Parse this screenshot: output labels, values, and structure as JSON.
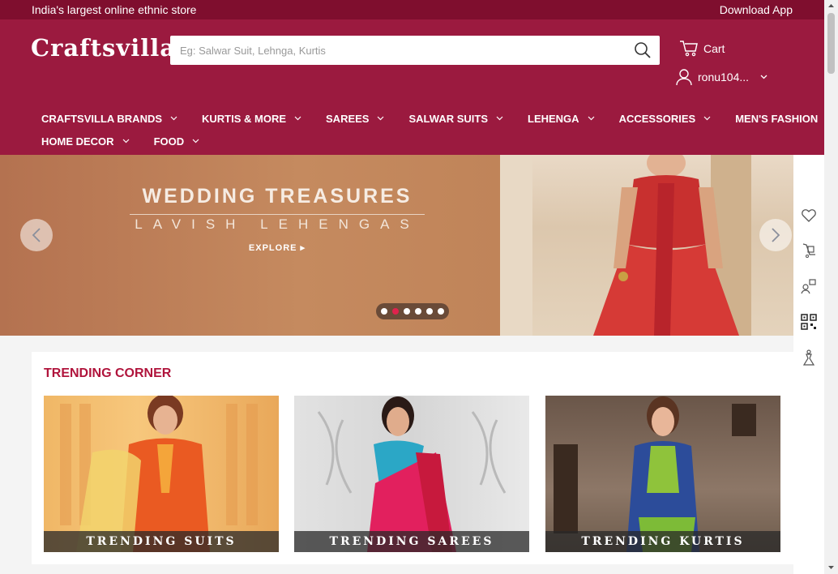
{
  "topbar": {
    "tagline": "India's largest online ethnic store",
    "download": "Download App"
  },
  "header": {
    "logo": "Craftsvilla",
    "search_placeholder": "Eg: Salwar Suit, Lehnga, Kurtis",
    "cart_label": "Cart",
    "user_label": "ronu104..."
  },
  "nav": {
    "row1": [
      "CRAFTSVILLA BRANDS",
      "KURTIS & MORE",
      "SAREES",
      "SALWAR SUITS",
      "LEHENGA",
      "ACCESSORIES",
      "MEN'S FASHION"
    ],
    "row2": [
      "HOME DECOR",
      "FOOD"
    ]
  },
  "banner": {
    "title": "WEDDING TREASURES",
    "subtitle": "LAVISH LEHENGAS",
    "cta": "EXPLORE ▸",
    "slide_count": 6,
    "active_slide": 2
  },
  "trending": {
    "title": "TRENDING CORNER",
    "cards": [
      "TRENDING SUITS",
      "TRENDING SAREES",
      "TRENDING KURTIS"
    ]
  },
  "sidebar_icons": [
    "wishlist-icon",
    "order-tracking-icon",
    "exchange-icon",
    "qr-code-icon",
    "stylist-icon"
  ],
  "colors": {
    "brand_dark": "#7f0e2e",
    "brand": "#9b1a3f",
    "accent_red": "#b0143c"
  }
}
